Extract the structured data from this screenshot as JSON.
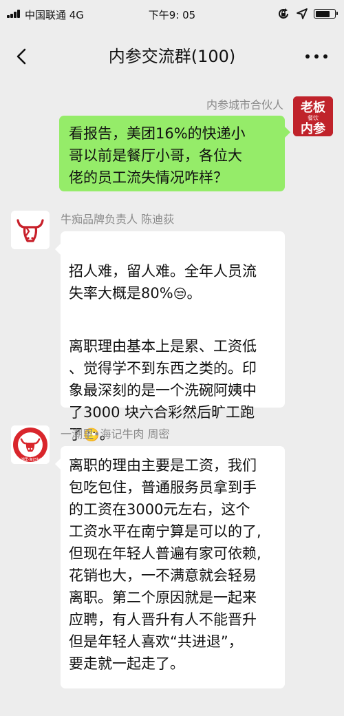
{
  "status_bar": {
    "carrier": "中国联通 4G",
    "time": "下午9: 05",
    "battery_level": 0.75,
    "icons": [
      "signal-icon",
      "lock-rotation-icon",
      "location-arrow-icon",
      "battery-icon"
    ]
  },
  "nav": {
    "title": "内参交流群(100)",
    "back_icon": "chevron-left-icon",
    "more_icon": "more-dots-icon"
  },
  "colors": {
    "background": "#ededed",
    "bubble_out": "#95ec69",
    "bubble_in": "#ffffff",
    "nickname": "#8a8a8a",
    "avatar_red": "#d9262c"
  },
  "messages": [
    {
      "nickname": "内参城市合伙人",
      "avatar_text": [
        "老板",
        "餐饮",
        "内参"
      ],
      "text": "看报告，美团16%的快递小\n哥以前是餐厅小哥，各位大\n佬的员工流失情况咋样？"
    },
    {
      "nickname": "牛痴品牌负责人  陈迪荻",
      "avatar_icon": "bull-head-logo-icon",
      "para1": "招人难，留人难。全年人员流\n失率大概是80%",
      "emoji1": "😒",
      "para1_end": "。",
      "para2": "离职理由基本上是累、工资低\n、觉得学不到东西之类的。印\n象最深刻的是一个洗碗阿姨中\n了3000 块六合彩然后旷工跑\n了",
      "emoji2": "🙄",
      "para2_end": "。"
    },
    {
      "nickname": "一潮里•海记牛肉  周密",
      "avatar_icon": "bull-circle-logo-icon",
      "avatar_ring_text": "一潮里·海记牛肉",
      "text": "离职的理由主要是工资，我们\n包吃包住，普通服务员拿到手\n的工资在3000元左右，这个\n工资水平在南宁算是可以的了,\n但现在年轻人普遍有家可依赖,\n花销也大，一不满意就会轻易\n离职。第二个原因就是一起来\n应聘，有人晋升有人不能晋升\n但是年轻人喜欢“共进退”，\n要走就一起走了。"
    }
  ]
}
